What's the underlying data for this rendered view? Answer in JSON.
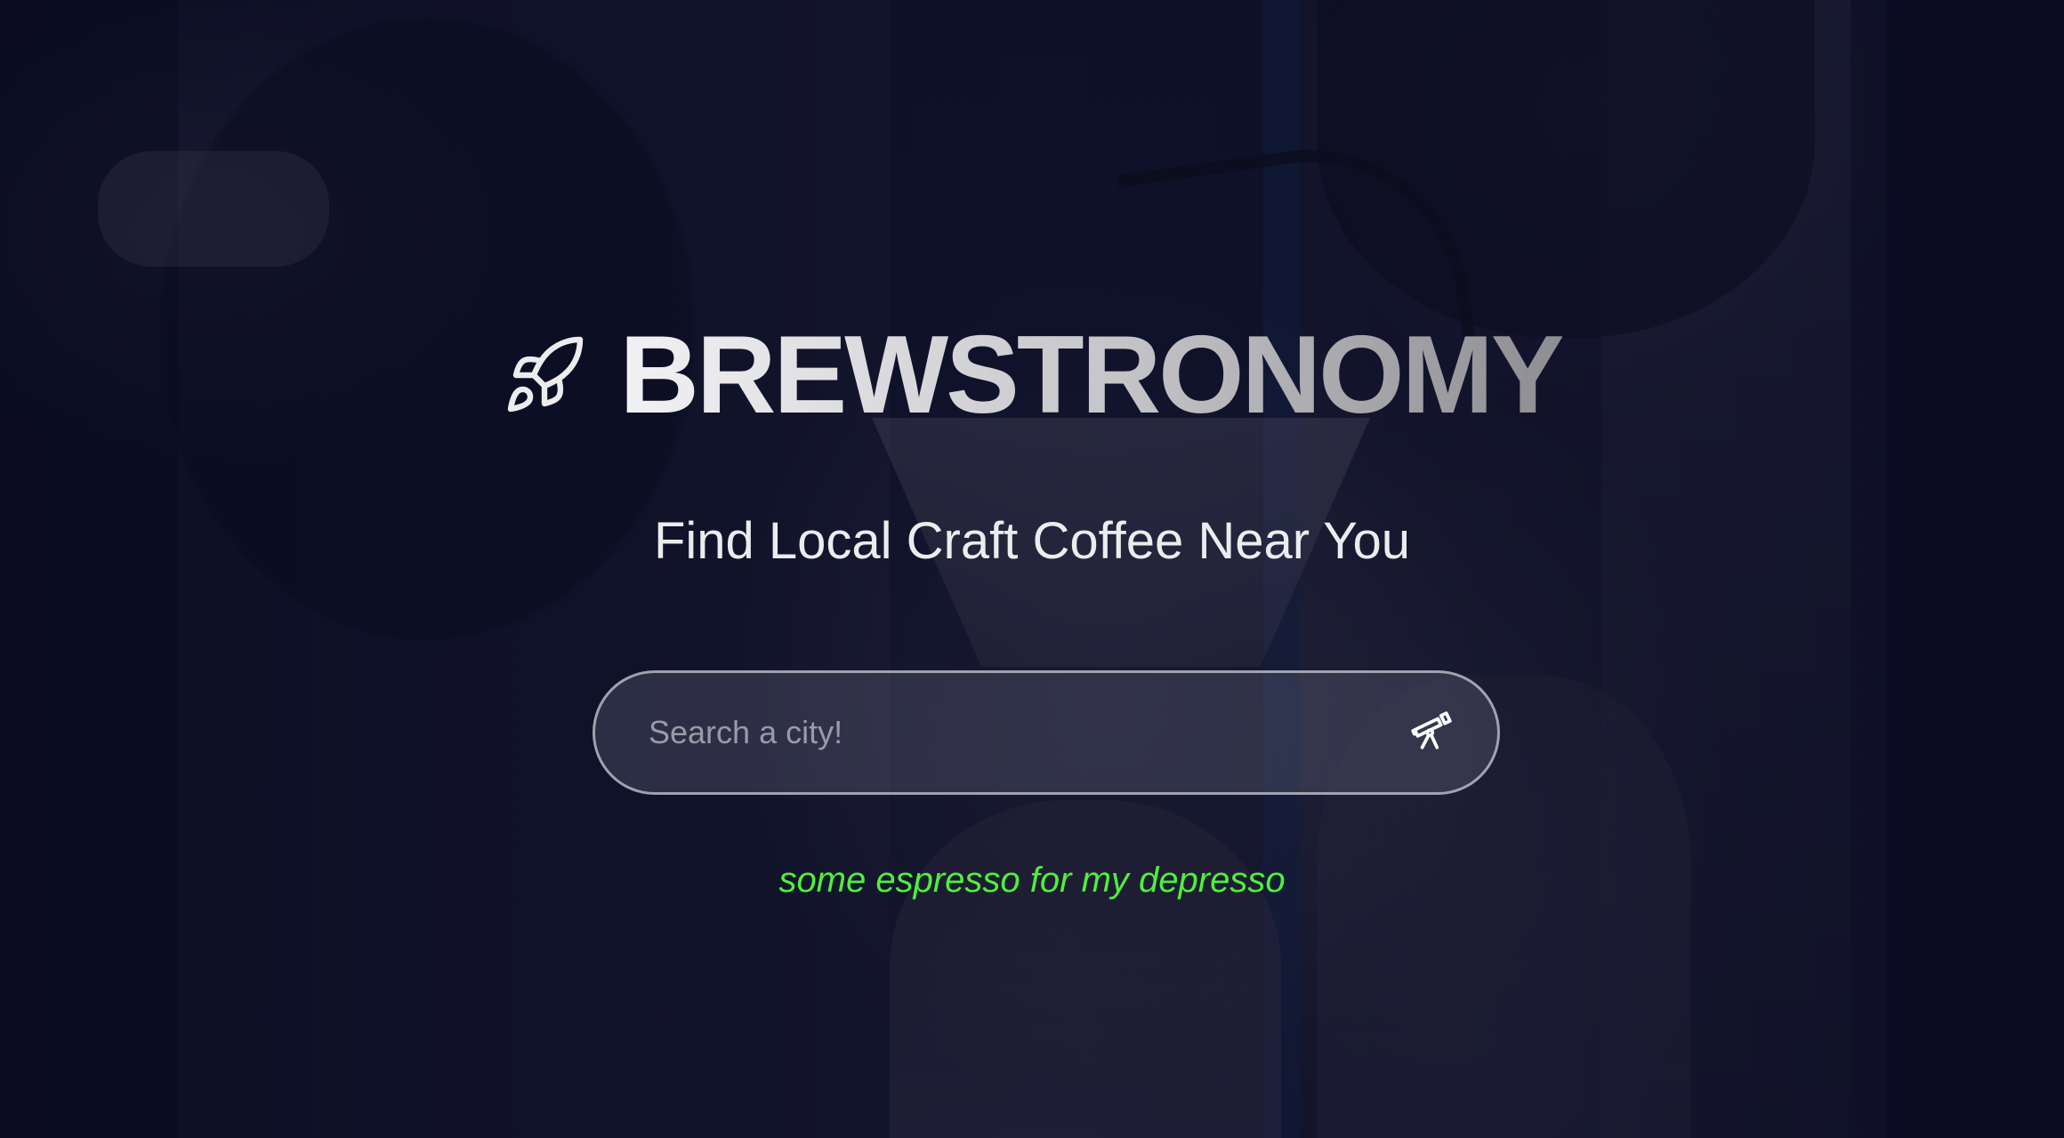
{
  "brand": {
    "title": "BREWSTRONOMY",
    "icon": "rocket-icon"
  },
  "hero": {
    "tagline": "Find Local Craft Coffee Near You"
  },
  "search": {
    "placeholder": "Search a city!",
    "value": "",
    "button_icon": "telescope-icon"
  },
  "motto": "some espresso for my depresso",
  "colors": {
    "motto": "#4ef03a",
    "title_gradient_start": "#f2f2f4",
    "title_gradient_end": "#8d8d92",
    "tagline": "#ececef"
  }
}
